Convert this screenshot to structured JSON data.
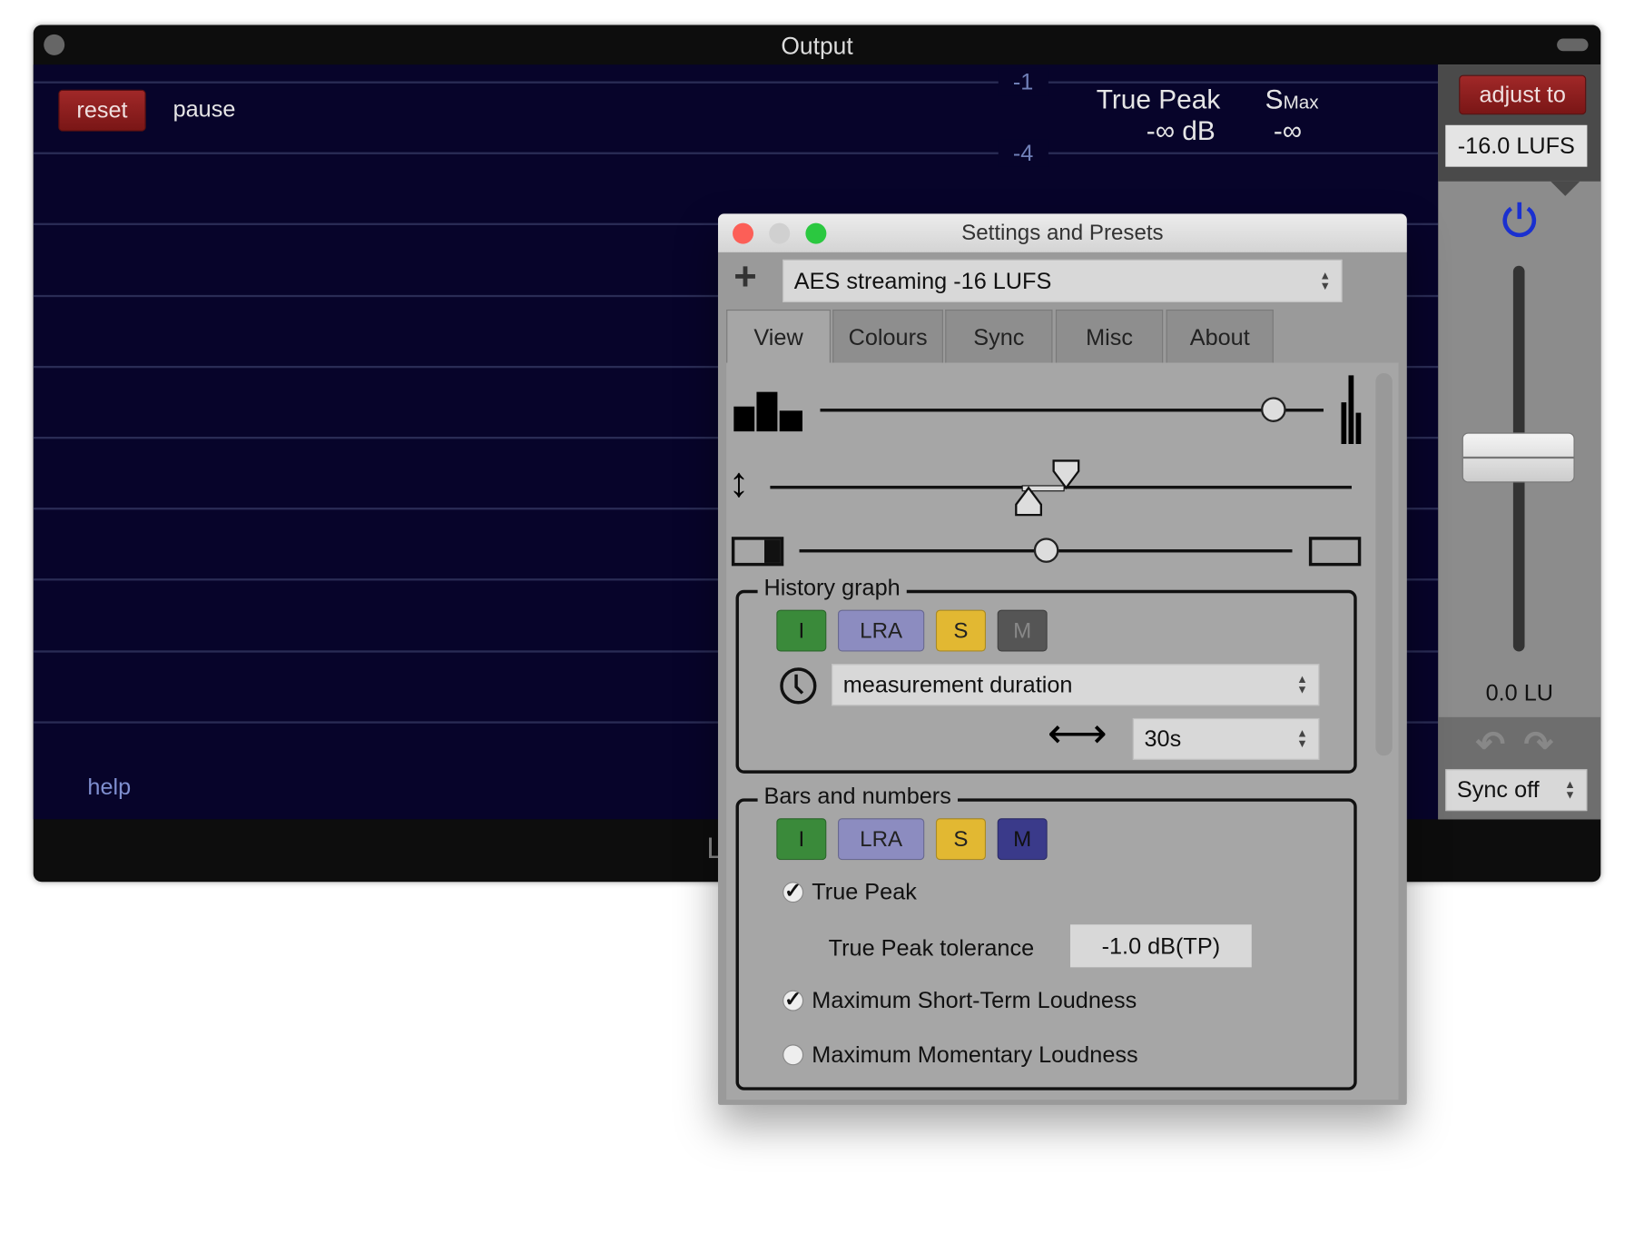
{
  "output_window": {
    "title": "Output",
    "reset_label": "reset",
    "pause_label": "pause",
    "help_label": "help",
    "scale_labels": [
      "-1",
      "-4"
    ],
    "true_peak_label": "True Peak",
    "true_peak_value": "-∞ dB",
    "smax_label": "S",
    "smax_sub": "Max",
    "smax_value": "-∞",
    "bottom_glyph": "L"
  },
  "right_panel": {
    "adjust_label": "adjust to",
    "target_value": "-16.0 LUFS",
    "gain_value": "0.0 LU",
    "gain_slider_percent": 50,
    "sync_value": "Sync off",
    "icons": [
      "power-icon",
      "undo-icon",
      "redo-icon"
    ]
  },
  "dialog": {
    "title": "Settings and Presets",
    "add_label": "+",
    "preset_value": "AES streaming -16 LUFS",
    "tabs": [
      {
        "label": "View",
        "active": true
      },
      {
        "label": "Colours"
      },
      {
        "label": "Sync"
      },
      {
        "label": "Misc"
      },
      {
        "label": "About"
      }
    ],
    "sliders": {
      "bar_width_percent": 90,
      "range_low_percent": 43,
      "range_high_percent": 50,
      "split_percent": 50
    },
    "history": {
      "legend": "History graph",
      "toggles": [
        {
          "label": "I",
          "color": "#3a8a3a"
        },
        {
          "label": "LRA",
          "color": "#8c8cc0"
        },
        {
          "label": "S",
          "color": "#e2b832"
        },
        {
          "label": "M",
          "color": "#555555"
        }
      ],
      "mode_value": "measurement duration",
      "duration_value": "30s"
    },
    "bars": {
      "legend": "Bars and numbers",
      "toggles": [
        {
          "label": "I",
          "color": "#3a8a3a"
        },
        {
          "label": "LRA",
          "color": "#8c8cc0"
        },
        {
          "label": "S",
          "color": "#e2b832"
        },
        {
          "label": "M",
          "color": "#3a3a8a"
        }
      ],
      "true_peak_label": "True Peak",
      "true_peak_checked": true,
      "tolerance_label": "True Peak tolerance",
      "tolerance_value": "-1.0 dB(TP)",
      "max_short_label": "Maximum Short-Term Loudness",
      "max_short_checked": true,
      "max_mom_label": "Maximum Momentary Loudness",
      "max_mom_checked": false
    }
  }
}
